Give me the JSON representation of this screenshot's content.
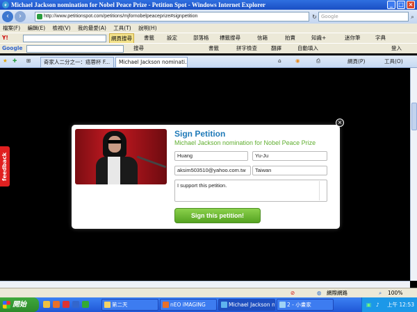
{
  "window": {
    "title": "Michael Jackson nomination for Nobel Peace Prize - Petition Spot - Windows Internet Explorer",
    "minimize": "_",
    "maximize": "□",
    "close": "×"
  },
  "address": {
    "url": "http://www.petitionspot.com/petitions/mjfornobelpeaceprize#signpetition",
    "search_placeholder": "Google"
  },
  "menu": [
    "檔案(F)",
    "編輯(E)",
    "檢視(V)",
    "我的最愛(A)",
    "工具(T)",
    "說明(H)"
  ],
  "yahoo_toolbar": {
    "logo": "Y!",
    "search_button": "網頁搜尋",
    "items": [
      "書籤",
      "設定",
      "部落格",
      "標籤搜尋",
      "信箱",
      "拍賣",
      "知識+",
      "迷你筆",
      "字典"
    ]
  },
  "google_toolbar": {
    "logo": "Google",
    "search_label": "搜尋",
    "items": [
      "書籤",
      "拼字檢查",
      "翻譯",
      "自動填入",
      "登入"
    ]
  },
  "tabs": [
    {
      "label": "奇家人二分之一：癌蓉杯 F..."
    },
    {
      "label": "Michael Jackson nominati..."
    }
  ],
  "tab_tools": {
    "page": "網頁(P)",
    "tools": "工具(O)"
  },
  "feedback": {
    "label": "feedback"
  },
  "petition": {
    "title": "Sign Petition",
    "subtitle": "Michael Jackson nomination for Nobel Peace Prize",
    "first_name": "Huang",
    "last_name": "Yu-Ju",
    "email": "aksim503510@yahoo.com.tw",
    "country": "Taiwan",
    "comment": "I support this petition.",
    "submit": "Sign this petition!",
    "close": "×"
  },
  "status": {
    "zone": "網際網路",
    "zoom": "100%"
  },
  "taskbar": {
    "start": "開始",
    "buttons": [
      {
        "label": "第二天"
      },
      {
        "label": "nEO iMAGING"
      },
      {
        "label": "Michael Jackson no..."
      },
      {
        "label": "2 - 小畫家"
      }
    ],
    "clock": "上午 12:53"
  },
  "colors": {
    "title_blue": "#1f7ab8",
    "subtitle_green": "#5fae2e",
    "button_green": "#55a321",
    "feedback_red": "#e02020"
  }
}
